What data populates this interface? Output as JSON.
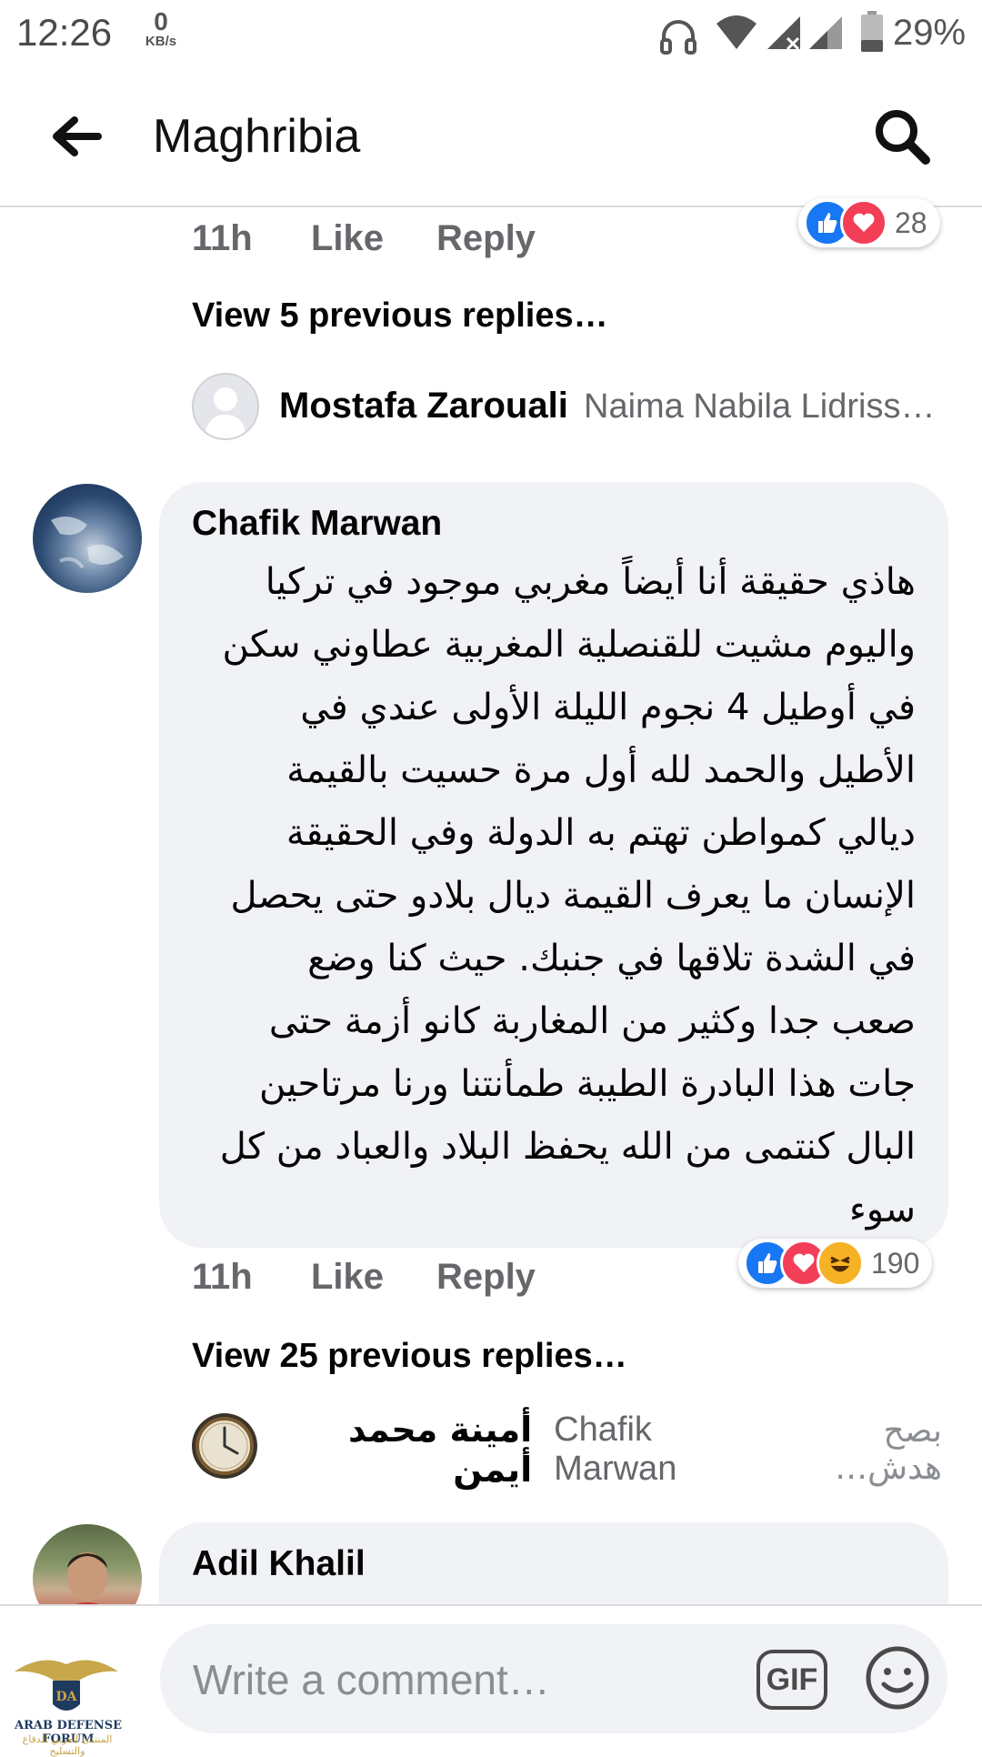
{
  "status_bar": {
    "time": "12:26",
    "net_speed_value": "0",
    "net_speed_unit": "KB/s",
    "battery": "29%"
  },
  "header": {
    "title": "Maghribia",
    "back_icon": "arrow-left-icon",
    "search_icon": "search-icon"
  },
  "comment_1_actions": {
    "time": "11h",
    "like": "Like",
    "reply": "Reply",
    "reaction_count": "28"
  },
  "thread_1": {
    "view_replies": "View 5 previous replies…",
    "reply_author": "Mostafa Zarouali",
    "reply_preview": "Naima Nabila Lidriss…"
  },
  "comment_2": {
    "author": "Chafik Marwan",
    "lines": [
      "هاذي حقيقة أنا أيضاً مغربي موجود في تركيا",
      "واليوم مشيت للقنصلية المغربية عطاوني سكن",
      "في أوطيل 4 نجوم الليلة الأولى عندي في",
      "الأطيل والحمد لله أول مرة حسيت بالقيمة",
      "ديالي كمواطن  تهتم به الدولة وفي الحقيقة",
      "الإنسان ما يعرف القيمة ديال بلادو حتى يحصل",
      "في الشدة تلاقها في جنبك. حيث كنا وضع",
      "صعب جدا وكثير من المغاربة كانو أزمة حتى",
      "جات هذا البادرة الطيبة طمأنتنا ورنا مرتاحين",
      "البال كنتمى من الله يحفظ البلاد والعباد من كل",
      "سوء"
    ],
    "time": "11h",
    "like": "Like",
    "reply": "Reply",
    "reaction_count": "190"
  },
  "thread_2": {
    "view_replies": "View 25 previous replies…",
    "reply_author": "أمينة محمد أيمن",
    "reply_mention": "Chafik Marwan",
    "reply_preview": "بصح هدش…"
  },
  "comment_3": {
    "author": "Adil Khalil"
  },
  "composer": {
    "placeholder": "Write a comment…",
    "gif_label": "GIF",
    "emoji_icon": "smiley-icon"
  },
  "watermark": {
    "logo_text": "ARAB DEFENSE FORUM",
    "logo_sub": "المنتدى العربي للدفاع والتسليح",
    "logo_letters": "DA"
  },
  "colors": {
    "like_blue": "#1877f2",
    "love_red": "#f33e58",
    "haha_yellow": "#f7b125",
    "bubble_gray": "#f0f2f5",
    "meta_gray": "#65676b"
  }
}
